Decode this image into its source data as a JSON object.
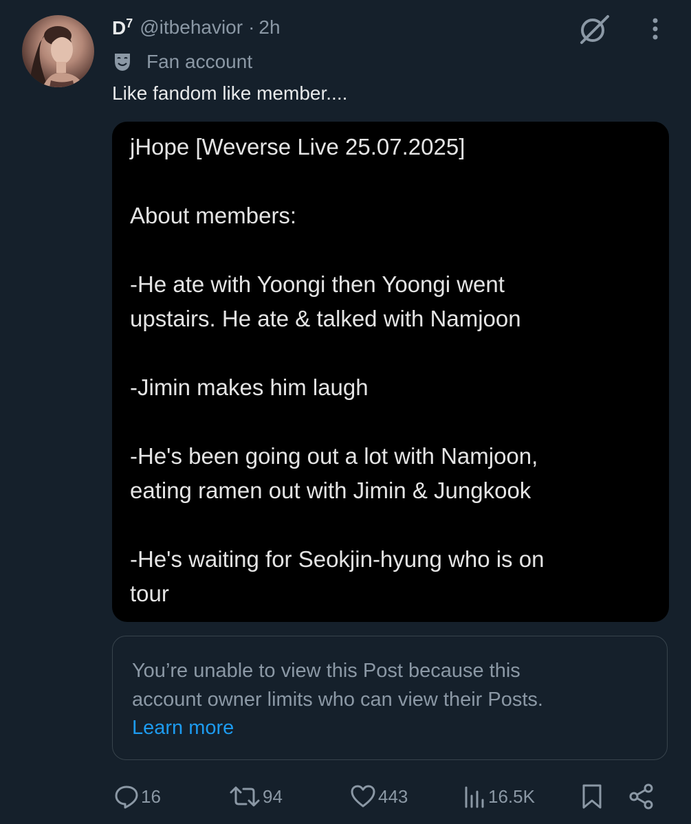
{
  "post": {
    "display_name": "D",
    "display_name_sup": "7",
    "handle": "@itbehavior",
    "separator": "·",
    "time": "2h",
    "affiliation_label": "Fan account",
    "text": "Like fandom like member...."
  },
  "media": {
    "lines": [
      "jHope [Weverse Live 25.07.2025]",
      "About members:",
      "-He ate with Yoongi then Yoongi went",
      "upstairs. He ate & talked with Namjoon",
      "-Jimin makes him laugh",
      "-He's been going out a lot with Namjoon,",
      "eating ramen out with Jimin & Jungkook",
      "-He's waiting for Seokjin-hyung who is on",
      "tour"
    ]
  },
  "quote": {
    "line1": "You’re unable to view this Post because this",
    "line2": "account owner limits who can view their Posts.",
    "link": "Learn more"
  },
  "actions": {
    "replies": "16",
    "reposts": "94",
    "likes": "443",
    "views": "16.5K"
  },
  "icons": {
    "grok": "grok-icon",
    "more": "more-vertical-icon",
    "affiliation": "theater-masks-icon",
    "reply": "reply-icon",
    "repost": "repost-icon",
    "like": "heart-icon",
    "views": "bar-chart-icon",
    "bookmark": "bookmark-icon",
    "share": "share-icon"
  },
  "colors": {
    "background": "#15202b",
    "text_primary": "#e7e9ea",
    "text_secondary": "#8b98a5",
    "link": "#1d9bf0",
    "border": "#38444d"
  }
}
